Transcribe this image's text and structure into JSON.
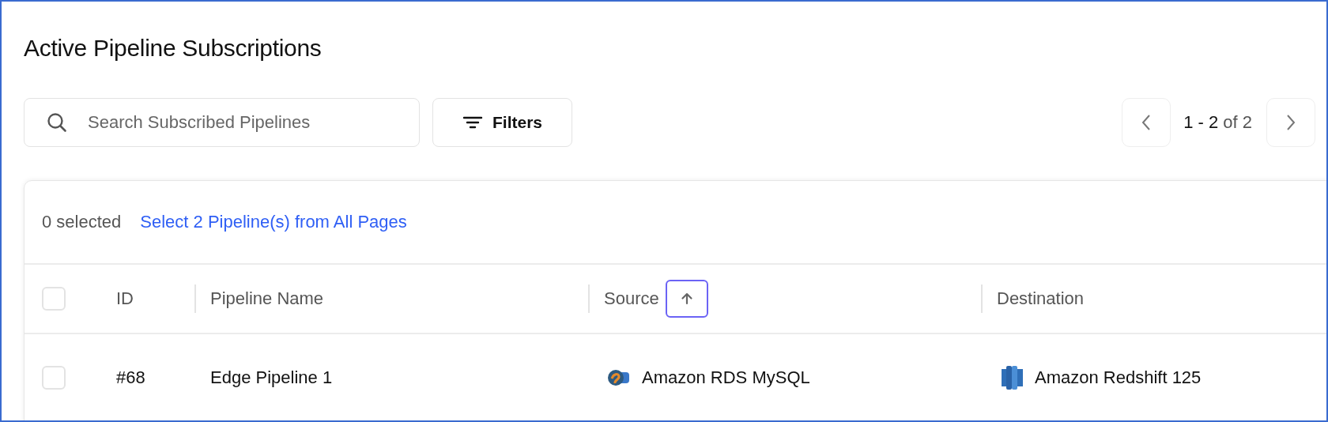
{
  "title": "Active Pipeline Subscriptions",
  "search": {
    "placeholder": "Search Subscribed Pipelines"
  },
  "filters_button": "Filters",
  "pager": {
    "range": "1 - 2",
    "total": "of 2"
  },
  "selection": {
    "count": "0 selected",
    "select_all_link": "Select 2 Pipeline(s) from All Pages",
    "checked": false
  },
  "table": {
    "columns": [
      {
        "label": "ID",
        "sorted": false
      },
      {
        "label": "Pipeline Name",
        "sorted": false
      },
      {
        "label": "Source",
        "sorted": true
      },
      {
        "label": "Destination",
        "sorted": false
      }
    ],
    "rows": [
      {
        "checked": false,
        "id": "#68",
        "name": "Edge Pipeline 1",
        "source": {
          "kind": "mysql",
          "label": "Amazon RDS MySQL"
        },
        "destination": {
          "kind": "redshift",
          "label": "Amazon Redshift 125"
        }
      }
    ]
  }
}
